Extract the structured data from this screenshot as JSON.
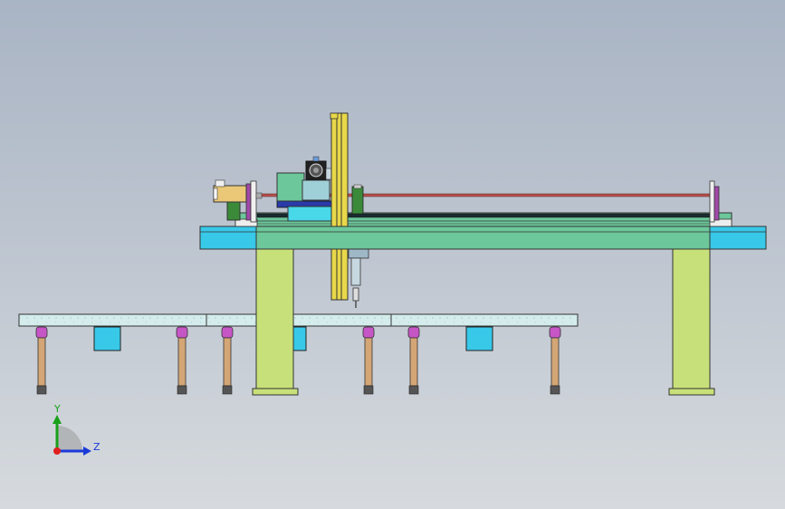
{
  "viewport": {
    "background_top": "#a9b4c4",
    "background_bottom": "#d6dade"
  },
  "colors": {
    "beam_cyan": "#38c8e8",
    "beam_green": "#6cc79b",
    "pillar": "#c8e07a",
    "table_top": "#d4ecec",
    "leg": "#d4a676",
    "leg_cap": "#c655c6",
    "bracket": "#38c8e8",
    "column_yellow": "#e8d84a",
    "rod": "#b8514a",
    "motor_green": "#3a8a3a",
    "carriage_blue": "#48a8c8"
  },
  "triad": {
    "y_label": "Y",
    "z_label": "Z",
    "y_color": "#1aa01a",
    "z_color": "#1a3ad8",
    "origin_color": "#e02020"
  }
}
